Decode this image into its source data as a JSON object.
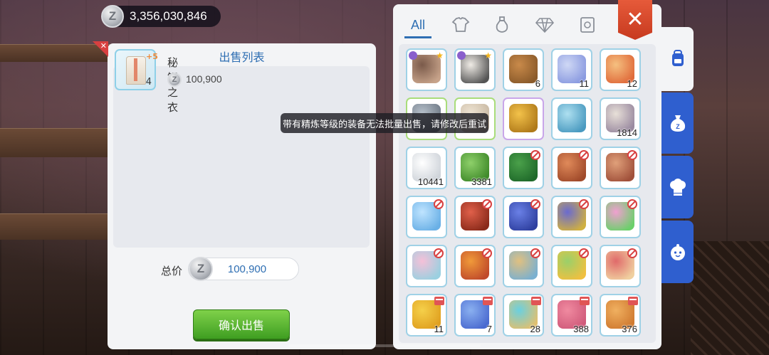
{
  "currency": {
    "amount": "3,356,030,846",
    "coin_symbol": "Z"
  },
  "sell_panel": {
    "title": "出售列表",
    "items": [
      {
        "name": "秘银之衣",
        "refine": "+5",
        "qty": "4",
        "price": "100,900"
      }
    ],
    "total_label": "总价",
    "total_value": "100,900",
    "confirm_label": "确认出售"
  },
  "tooltip": "带有精炼等级的装备无法批量出售，请修改后重试",
  "inventory": {
    "tabs": [
      {
        "label": "All",
        "icon": "all-tab"
      },
      {
        "label": "",
        "icon": "armor-icon"
      },
      {
        "label": "",
        "icon": "potion-icon"
      },
      {
        "label": "",
        "icon": "gem-icon"
      },
      {
        "label": "",
        "icon": "card-icon"
      }
    ],
    "close_label": "✕",
    "slots": [
      {
        "name": "card-werewolf",
        "count": "",
        "border": "blue",
        "badge": "star",
        "colors": [
          "#7a5a4a",
          "#c7a38a"
        ]
      },
      {
        "name": "card-pierrot",
        "count": "",
        "border": "blue",
        "badge": "star",
        "colors": [
          "#f0ece6",
          "#555"
        ]
      },
      {
        "name": "leather-bag",
        "count": "6",
        "border": "blue",
        "badge": "",
        "colors": [
          "#c98a4a",
          "#8a5a2a"
        ]
      },
      {
        "name": "ribbon",
        "count": "11",
        "border": "blue",
        "badge": "",
        "colors": [
          "#cfd8f5",
          "#8a9ae0"
        ]
      },
      {
        "name": "potion-flask",
        "count": "12",
        "border": "blue",
        "badge": "",
        "colors": [
          "#f5c080",
          "#e06a3a"
        ]
      },
      {
        "name": "grey-stone",
        "count": "",
        "border": "green",
        "badge": "",
        "colors": [
          "#b8c2cc",
          "#6f7a86"
        ]
      },
      {
        "name": "cloth",
        "count": "",
        "border": "green",
        "badge": "",
        "colors": [
          "#efe5d4",
          "#c9b9a3"
        ]
      },
      {
        "name": "gold-shard",
        "count": "",
        "border": "purple",
        "badge": "",
        "colors": [
          "#f3c24a",
          "#b07a1a"
        ]
      },
      {
        "name": "fish-scale",
        "count": "",
        "border": "blue",
        "badge": "",
        "colors": [
          "#aee0f0",
          "#4a9ac0"
        ]
      },
      {
        "name": "feather",
        "count": "1814",
        "border": "blue",
        "badge": "",
        "colors": [
          "#e8e0d8",
          "#9a8aa0"
        ]
      },
      {
        "name": "white-feather",
        "count": "10441",
        "border": "blue",
        "badge": "",
        "colors": [
          "#ffffff",
          "#cfd4da"
        ]
      },
      {
        "name": "green-herb",
        "count": "3381",
        "border": "blue",
        "badge": "",
        "colors": [
          "#8ed06a",
          "#3f8a2a"
        ]
      },
      {
        "name": "green-book",
        "count": "",
        "border": "blue",
        "badge": "ban",
        "colors": [
          "#4aa04a",
          "#1f6a2a"
        ]
      },
      {
        "name": "coin-bag",
        "count": "",
        "border": "blue",
        "badge": "ban",
        "colors": [
          "#e08a5a",
          "#a04a2a"
        ]
      },
      {
        "name": "pet-basket",
        "count": "",
        "border": "blue",
        "badge": "ban",
        "colors": [
          "#e0a07a",
          "#a0503a"
        ]
      },
      {
        "name": "crystal-box",
        "count": "",
        "border": "blue",
        "badge": "ban",
        "colors": [
          "#bfe4ff",
          "#6ab0e6"
        ]
      },
      {
        "name": "red-chest",
        "count": "",
        "border": "blue",
        "badge": "ban",
        "colors": [
          "#e0604a",
          "#8a2a1a"
        ]
      },
      {
        "name": "blue-scroll",
        "count": "",
        "border": "blue",
        "badge": "ban",
        "colors": [
          "#6a80e6",
          "#2f40a0"
        ]
      },
      {
        "name": "star-box",
        "count": "",
        "border": "blue",
        "badge": "ban",
        "colors": [
          "#6a6ad0",
          "#d0b040"
        ]
      },
      {
        "name": "pink-box",
        "count": "",
        "border": "blue",
        "badge": "ban",
        "colors": [
          "#f0a0d0",
          "#6ad06a"
        ]
      },
      {
        "name": "gift-box",
        "count": "",
        "border": "blue",
        "badge": "ban",
        "colors": [
          "#f5c0d8",
          "#9ad0e0"
        ]
      },
      {
        "name": "orange-book",
        "count": "",
        "border": "blue",
        "badge": "ban",
        "colors": [
          "#f09a3a",
          "#c04a2a"
        ]
      },
      {
        "name": "tower-box",
        "count": "",
        "border": "blue",
        "badge": "ban",
        "colors": [
          "#e0c080",
          "#7ab0d0"
        ]
      },
      {
        "name": "green-crate",
        "count": "",
        "border": "blue",
        "badge": "ban",
        "colors": [
          "#9ad06a",
          "#f0c040"
        ]
      },
      {
        "name": "pink-chest",
        "count": "",
        "border": "blue",
        "badge": "ban",
        "colors": [
          "#e06a6a",
          "#f0d0a0"
        ]
      },
      {
        "name": "gold-ticket",
        "count": "11",
        "border": "blue",
        "badge": "shop",
        "colors": [
          "#f5d04a",
          "#e0a020"
        ]
      },
      {
        "name": "moon-charm",
        "count": "7",
        "border": "blue",
        "badge": "shop",
        "colors": [
          "#8ab0f0",
          "#4a6ad0"
        ]
      },
      {
        "name": "cyan-emblem",
        "count": "28",
        "border": "blue",
        "badge": "shop",
        "colors": [
          "#6ad0e0",
          "#e0c070"
        ]
      },
      {
        "name": "pink-puzzle",
        "count": "388",
        "border": "blue",
        "badge": "shop",
        "colors": [
          "#f08aa0",
          "#d05a7a"
        ]
      },
      {
        "name": "orange-puzzle",
        "count": "376",
        "border": "blue",
        "badge": "shop",
        "colors": [
          "#f0b060",
          "#d07a30"
        ]
      }
    ]
  },
  "side_tabs": [
    {
      "name": "bag-tab",
      "active": true
    },
    {
      "name": "zeny-bag-tab",
      "active": false
    },
    {
      "name": "chef-hat-tab",
      "active": false
    },
    {
      "name": "pet-tab",
      "active": false
    }
  ]
}
